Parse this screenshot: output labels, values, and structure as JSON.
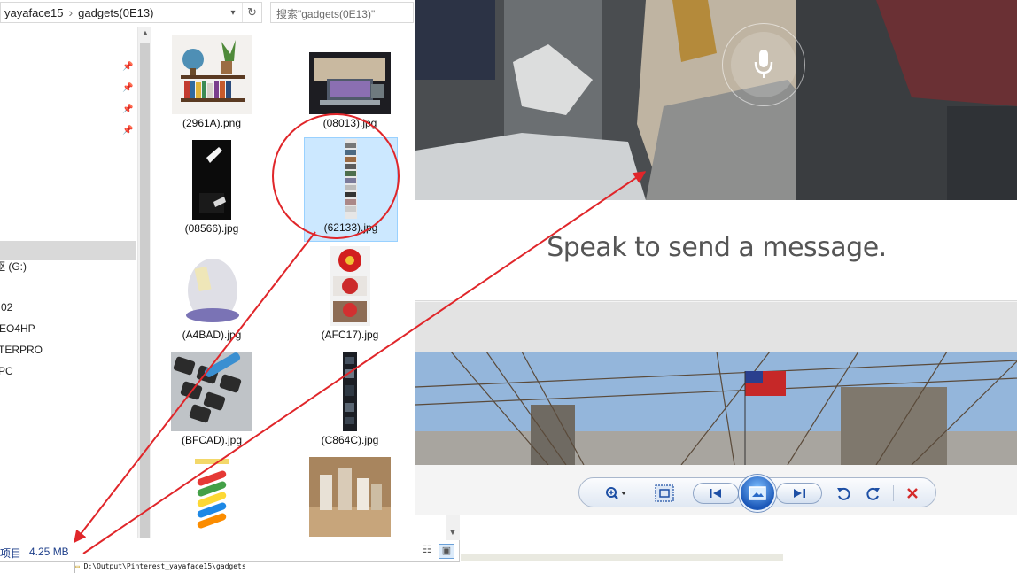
{
  "explorer": {
    "address": {
      "segments": [
        "yayaface15",
        "gadgets(0E13)"
      ],
      "separator": "›",
      "dropdown_icon": "chevron-down-icon",
      "refresh_icon": "refresh-icon"
    },
    "search_placeholder": "搜索\"gadgets(0E13)\"",
    "nav_items": [
      "驱 (G:)",
      "02",
      "EO4HP",
      "TERPRO",
      "PC"
    ],
    "files": [
      {
        "name": "(2961A).png"
      },
      {
        "name": "(08013).jpg"
      },
      {
        "name": "(08566).jpg"
      },
      {
        "name": "(62133).jpg"
      },
      {
        "name": "(A4BAD).jpg"
      },
      {
        "name": "(AFC17).jpg"
      },
      {
        "name": "(BFCAD).jpg"
      },
      {
        "name": "(C864C).jpg"
      },
      {
        "name": ""
      },
      {
        "name": ""
      }
    ],
    "status": {
      "items_label": "项目",
      "size": "4.25 MB"
    },
    "path": "D:\\Output\\Pinterest_yayaface15\\gadgets"
  },
  "viewer": {
    "message": "Speak to send a message.",
    "mic_icon": "microphone-icon",
    "controls": {
      "zoom_icon": "zoom-icon",
      "fit_icon": "actual-size-icon",
      "prev_icon": "previous-icon",
      "slideshow_icon": "slideshow-icon",
      "next_icon": "next-icon",
      "rotate_left_icon": "rotate-counterclockwise-icon",
      "rotate_right_icon": "rotate-clockwise-icon",
      "delete_icon": "delete-icon"
    }
  },
  "annotation_color": "#e0262a"
}
